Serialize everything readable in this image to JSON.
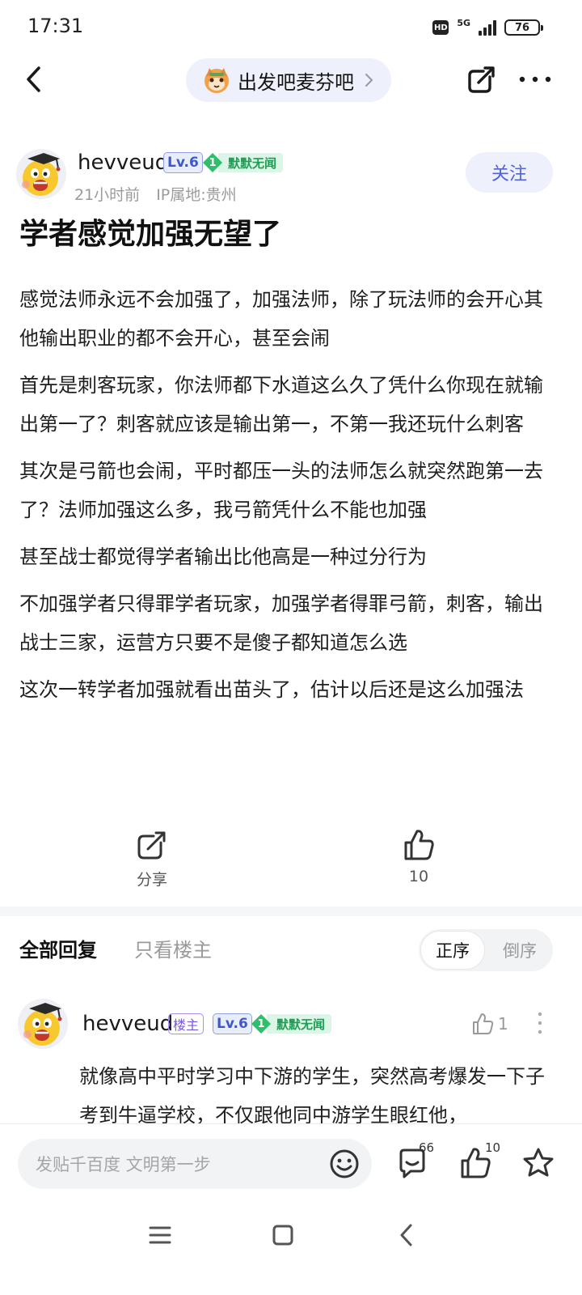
{
  "status_bar": {
    "time": "17:31",
    "hd": "HD",
    "network": "5G",
    "battery": "76"
  },
  "nav": {
    "forum_name": "出发吧麦芬吧",
    "icons": [
      "back-icon",
      "share-icon",
      "more-icon",
      "chevron-right-icon"
    ]
  },
  "author": {
    "name": "hevveud",
    "level": "Lv.6",
    "honor_level": "1",
    "honor_title": "默默无闻",
    "time": "21小时前",
    "ip": "IP属地:贵州",
    "follow_label": "关注"
  },
  "post": {
    "title": "学者感觉加强无望了",
    "paragraphs": [
      "感觉法师永远不会加强了，加强法师，除了玩法师的会开心其他输出职业的都不会开心，甚至会闹",
      "首先是刺客玩家，你法师都下水道这么久了凭什么你现在就输出第一了？刺客就应该是输出第一，不第一我还玩什么刺客",
      "其次是弓箭也会闹，平时都压一头的法师怎么就突然跑第一去了？法师加强这么多，我弓箭凭什么不能也加强",
      "甚至战士都觉得学者输出比他高是一种过分行为",
      "不加强学者只得罪学者玩家，加强学者得罪弓箭，刺客，输出战士三家，运营方只要不是傻子都知道怎么选",
      "这次一转学者加强就看出苗头了，估计以后还是这么加强法"
    ]
  },
  "actions": {
    "share_label": "分享",
    "like_count": "10"
  },
  "replies_header": {
    "tab_all": "全部回复",
    "tab_host_only": "只看楼主",
    "sort_asc": "正序",
    "sort_desc": "倒序"
  },
  "reply": {
    "name": "hevveud",
    "host_badge": "楼主",
    "level": "Lv.6",
    "honor_level": "1",
    "honor_title": "默默无闻",
    "like_count": "1",
    "text": "就像高中平时学习中下游的学生，突然高考爆发一下子考到牛逼学校，不仅跟他同中游学生眼红他，"
  },
  "bottom_bar": {
    "input_placeholder": "发贴千百度 文明第一步",
    "comment_count": "66",
    "like_count": "10"
  },
  "colors": {
    "accent": "#5163d6",
    "level_badge": "#3e58c9",
    "honor_green": "#1e9c53",
    "host_purple": "#7a56e0"
  }
}
